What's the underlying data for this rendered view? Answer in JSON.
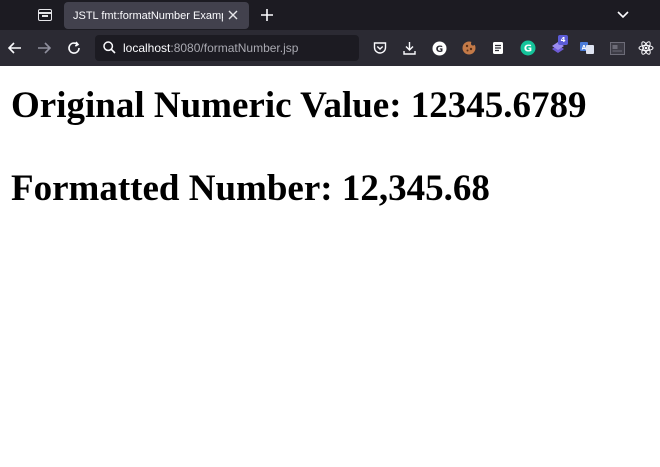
{
  "browser": {
    "tab": {
      "title": "JSTL fmt:formatNumber Example"
    },
    "url": {
      "host": "localhost",
      "rest": ":8080/formatNumber.jsp"
    },
    "icons": {
      "tab_list": "tab-list-icon",
      "close": "close-icon",
      "new_tab": "plus-icon",
      "overflow": "chevron-down-icon",
      "back": "back-arrow-icon",
      "forward": "forward-arrow-icon",
      "reload": "reload-icon",
      "search": "search-icon"
    },
    "extensions": [
      {
        "name": "pocket-icon"
      },
      {
        "name": "download-icon"
      },
      {
        "name": "g-extension-icon",
        "label": "G"
      },
      {
        "name": "cookie-icon"
      },
      {
        "name": "notes-icon"
      },
      {
        "name": "grammarly-icon",
        "label": "G",
        "color": "#15c39a"
      },
      {
        "name": "stack-extension-icon",
        "badge": "4",
        "color": "#5b5bd6"
      },
      {
        "name": "translate-icon"
      },
      {
        "name": "screenshot-icon"
      },
      {
        "name": "react-devtools-icon"
      }
    ]
  },
  "page": {
    "line1": "Original Numeric Value: 12345.6789",
    "line2": "Formatted Number: 12,345.68"
  }
}
